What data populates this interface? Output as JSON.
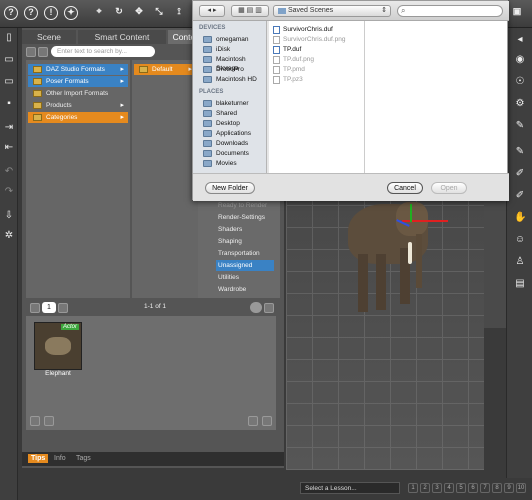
{
  "panel": {
    "tabs": [
      "Scene",
      "Smart Content",
      "Content L"
    ],
    "search_placeholder": "Enter text to search by...",
    "categories": [
      {
        "label": "DAZ Studio Formats",
        "state": "selected-blue"
      },
      {
        "label": "Poser Formats",
        "state": "selected-blue"
      },
      {
        "label": "Other Import Formats",
        "state": "normal"
      },
      {
        "label": "Products",
        "state": "normal"
      },
      {
        "label": "Categories",
        "state": "selected-orange"
      }
    ],
    "subcategory": "Default",
    "right_list": [
      "Ready to Render",
      "Render-Settings",
      "Shaders",
      "Shaping",
      "Transportation",
      "Unassigned",
      "Utilities",
      "Wardrobe"
    ],
    "right_selected": "Unassigned",
    "page_number": "1",
    "count_label": "1-1 of 1",
    "thumbnail": {
      "badge": "Actor",
      "label": "Elephant"
    },
    "footer_tabs": [
      "Tips",
      "Info",
      "Tags"
    ]
  },
  "dialog": {
    "location": "Saved Scenes",
    "devices_header": "DEVICES",
    "devices": [
      "omegaman",
      "iDisk",
      "Macintosh Storage",
      "DroboPro",
      "Macintosh HD"
    ],
    "places_header": "PLACES",
    "places": [
      "blaketurner",
      "Shared",
      "Desktop",
      "Applications",
      "Downloads",
      "Documents",
      "Movies"
    ],
    "files": [
      {
        "name": "SurvivorChris.duf",
        "enabled": true
      },
      {
        "name": "SurvivorChris.duf.png",
        "enabled": false
      },
      {
        "name": "TP.duf",
        "enabled": true
      },
      {
        "name": "TP.duf.png",
        "enabled": false
      },
      {
        "name": "TP.pmd",
        "enabled": false
      },
      {
        "name": "TP.pz3",
        "enabled": false
      }
    ],
    "new_folder": "New Folder",
    "cancel": "Cancel",
    "open": "Open"
  },
  "bottom": {
    "lesson_placeholder": "Select a Lesson...",
    "pages": [
      "1",
      "2",
      "3",
      "4",
      "5",
      "6",
      "7",
      "8",
      "9",
      "10"
    ]
  }
}
